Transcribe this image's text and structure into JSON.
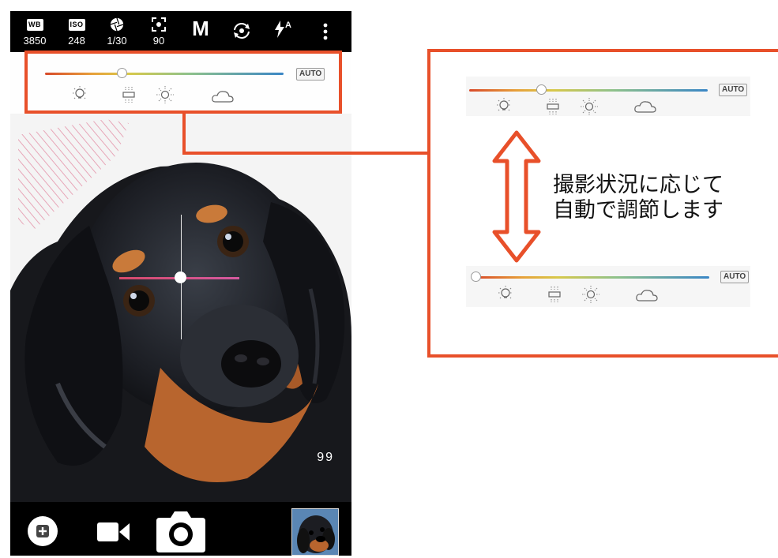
{
  "toolbar": {
    "wb": {
      "icon_text": "WB",
      "value": "3850"
    },
    "iso": {
      "icon_text": "ISO",
      "value": "248"
    },
    "shutter": {
      "icon": "aperture-icon",
      "value": "1/30"
    },
    "focus": {
      "icon": "focus-frame-icon",
      "value": "90"
    },
    "mode": "M",
    "switch_camera_icon": "camera-switch-icon",
    "flash_icon": "flash-auto-icon",
    "flash_label": "A",
    "more_icon": "more-vert-icon"
  },
  "wb_panel": {
    "auto_label": "AUTO",
    "presets": [
      "incandescent-icon",
      "fluorescent-icon",
      "daylight-icon",
      "cloudy-icon"
    ],
    "level": 0.32
  },
  "viewfinder": {
    "shot_counter": "99",
    "level_cross": true
  },
  "bottom": {
    "add_icon": "plus-icon",
    "video_icon": "video-camera-icon",
    "shutter_icon": "shutter-camera-icon",
    "thumbnail": "gallery-thumbnail"
  },
  "callout": {
    "text_line1": "撮影状況に応じて",
    "text_line2": "自動で調節します",
    "preview_top": {
      "auto_label": "AUTO",
      "level": 0.3
    },
    "preview_bottom": {
      "auto_label": "AUTO",
      "level": 0.0
    }
  },
  "colors": {
    "annotation": "#e8502a"
  }
}
